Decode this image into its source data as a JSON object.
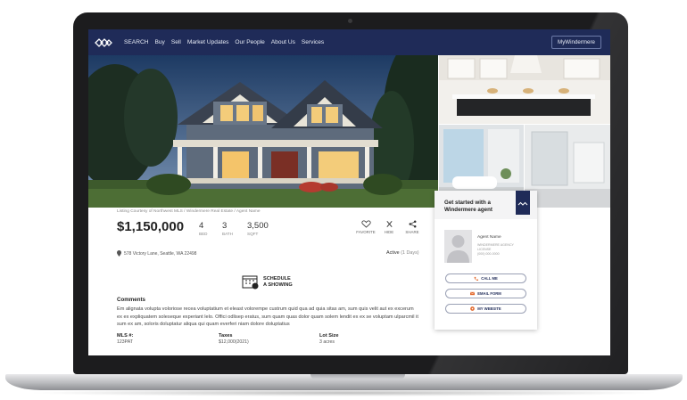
{
  "nav": {
    "items": [
      "SEARCH",
      "Buy",
      "Sell",
      "Market Updates",
      "Our People",
      "About Us",
      "Services"
    ],
    "account_button": "MyWindermere"
  },
  "listing": {
    "courtesy": "Listing Courtesy of Northwest MLS / Windermere Real Estate / Agent Name",
    "price": "$1,150,000",
    "beds": {
      "value": "4",
      "label": "BED"
    },
    "baths": {
      "value": "3",
      "label": "BATH"
    },
    "sqft": {
      "value": "3,500",
      "label": "SQFT"
    },
    "address": "578 Victory Lane, Seattle, WA 22498",
    "status_label": "Active",
    "status_days": "(1 Days)"
  },
  "actions": [
    {
      "label": "FAVORITE",
      "icon": "heart-icon"
    },
    {
      "label": "HIDE",
      "icon": "close-icon"
    },
    {
      "label": "SHARE",
      "icon": "share-icon"
    }
  ],
  "schedule": {
    "line1": "SCHEDULE",
    "line2": "A SHOWING",
    "icon": "calendar-icon"
  },
  "comments": {
    "heading": "Comments",
    "text": "Em alignata volupta voloriose recea voluptatium et eleast volorempe custrum quid qua ad quia sitas am, sum quis velit aut ex excerum ex ex expliquatem soleseque experiant lelo. Offici odlisep eratus, sum quam quas dolor quam solem lendit ex ex se voluptam ulparcmil it sum ex am, soloris doluptatur aliqua qui quam everferi niam dolore doluptatius"
  },
  "facts": [
    {
      "heading": "MLS #:",
      "value": "123PAT"
    },
    {
      "heading": "Taxes",
      "value": "$12,000(2021)"
    },
    {
      "heading": "Lot Size",
      "value": "3 acres"
    }
  ],
  "agent_card": {
    "title": "Get started with a Windermere agent",
    "agent_name": "Agent Name",
    "detail_lines": [
      "WINDERMERE AGENCY",
      "LICENSE",
      "(000) 000-0000"
    ],
    "buttons": [
      {
        "label": "CALL ME",
        "icon": "phone-icon"
      },
      {
        "label": "EMAIL FORM",
        "icon": "email-icon"
      },
      {
        "label": "MY WEBSITE",
        "icon": "globe-icon"
      }
    ]
  },
  "gallery": {
    "prev": "‹",
    "next": "›"
  },
  "colors": {
    "brand_navy": "#1f2b58",
    "accent_orange": "#e2672a"
  }
}
